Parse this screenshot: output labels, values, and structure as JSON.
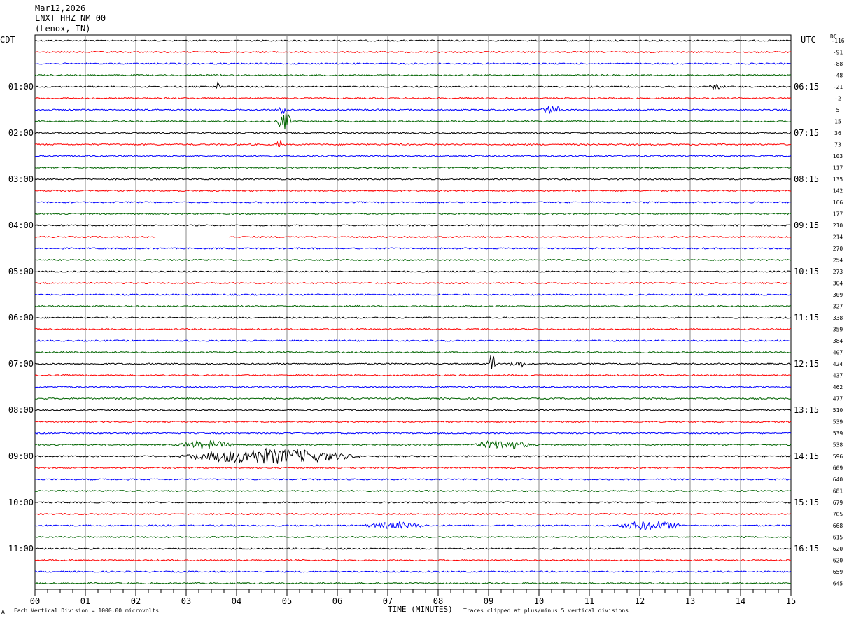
{
  "header": {
    "date": "Mar12,2026",
    "station": "LNXT HHZ NM 00",
    "location": "(Lenox, TN)"
  },
  "left_axis_label": "CDT",
  "right_axis_label": "UTC",
  "dc_label": "DC",
  "footer": {
    "scale_note": "Each Vertical Division = 1000.00 microvolts",
    "clip_note": "Traces clipped at plus/minus 5 vertical divisions",
    "x_title": "TIME (MINUTES)",
    "corner_mark": "A"
  },
  "colors": {
    "trace_cycle": [
      "#000000",
      "#ff0000",
      "#0000ff",
      "#006400"
    ],
    "grid": "#888888"
  },
  "chart_data": {
    "type": "line",
    "title": "LNXT HHZ NM 00",
    "xlabel": "TIME (MINUTES)",
    "xlim": [
      0,
      15
    ],
    "x_ticks": [
      "00",
      "01",
      "02",
      "03",
      "04",
      "05",
      "06",
      "07",
      "08",
      "09",
      "10",
      "11",
      "12",
      "13",
      "14",
      "15"
    ],
    "rows_count": 48,
    "left_hour_labels": [
      {
        "row": 4,
        "label": "01:00"
      },
      {
        "row": 8,
        "label": "02:00"
      },
      {
        "row": 12,
        "label": "03:00"
      },
      {
        "row": 16,
        "label": "04:00"
      },
      {
        "row": 20,
        "label": "05:00"
      },
      {
        "row": 24,
        "label": "06:00"
      },
      {
        "row": 28,
        "label": "07:00"
      },
      {
        "row": 32,
        "label": "08:00"
      },
      {
        "row": 36,
        "label": "09:00"
      },
      {
        "row": 40,
        "label": "10:00"
      },
      {
        "row": 44,
        "label": "11:00"
      }
    ],
    "right_hour_labels": [
      {
        "row": 4,
        "label": "06:15"
      },
      {
        "row": 8,
        "label": "07:15"
      },
      {
        "row": 12,
        "label": "08:15"
      },
      {
        "row": 16,
        "label": "09:15"
      },
      {
        "row": 20,
        "label": "10:15"
      },
      {
        "row": 24,
        "label": "11:15"
      },
      {
        "row": 28,
        "label": "12:15"
      },
      {
        "row": 32,
        "label": "13:15"
      },
      {
        "row": 36,
        "label": "14:15"
      },
      {
        "row": 40,
        "label": "15:15"
      },
      {
        "row": 44,
        "label": "16:15"
      }
    ],
    "dc_offsets": [
      "-116",
      "-91",
      "-88",
      "-48",
      "-21",
      "-2",
      "5",
      "15",
      "36",
      "73",
      "103",
      "117",
      "135",
      "142",
      "166",
      "177",
      "210",
      "214",
      "270",
      "254",
      "273",
      "304",
      "309",
      "327",
      "338",
      "359",
      "384",
      "407",
      "424",
      "437",
      "462",
      "477",
      "510",
      "539",
      "539",
      "538",
      "596",
      "609",
      "640",
      "681",
      "679",
      "705",
      "668",
      "615",
      "620",
      "620",
      "659",
      "645"
    ],
    "events": [
      {
        "row": 4,
        "start_min": 3.6,
        "end_min": 3.7,
        "amp": 10
      },
      {
        "row": 4,
        "start_min": 13.3,
        "end_min": 13.7,
        "amp": 3
      },
      {
        "row": 6,
        "start_min": 4.8,
        "end_min": 5.0,
        "amp": 6
      },
      {
        "row": 6,
        "start_min": 10.0,
        "end_min": 10.5,
        "amp": 5
      },
      {
        "row": 7,
        "start_min": 4.8,
        "end_min": 5.1,
        "amp": 13
      },
      {
        "row": 9,
        "start_min": 4.8,
        "end_min": 4.9,
        "amp": 8
      },
      {
        "row": 28,
        "start_min": 9.0,
        "end_min": 9.15,
        "amp": 16
      },
      {
        "row": 28,
        "start_min": 9.4,
        "end_min": 9.8,
        "amp": 4
      },
      {
        "row": 35,
        "start_min": 2.8,
        "end_min": 4.0,
        "amp": 5
      },
      {
        "row": 35,
        "start_min": 8.7,
        "end_min": 9.9,
        "amp": 6
      },
      {
        "row": 36,
        "start_min": 2.8,
        "end_min": 6.5,
        "amp": 10
      },
      {
        "row": 42,
        "start_min": 6.5,
        "end_min": 7.8,
        "amp": 4
      },
      {
        "row": 42,
        "start_min": 11.5,
        "end_min": 12.9,
        "amp": 6
      }
    ],
    "gaps": [
      {
        "row": 17,
        "start_min": 2.4,
        "end_min": 3.85
      }
    ]
  }
}
